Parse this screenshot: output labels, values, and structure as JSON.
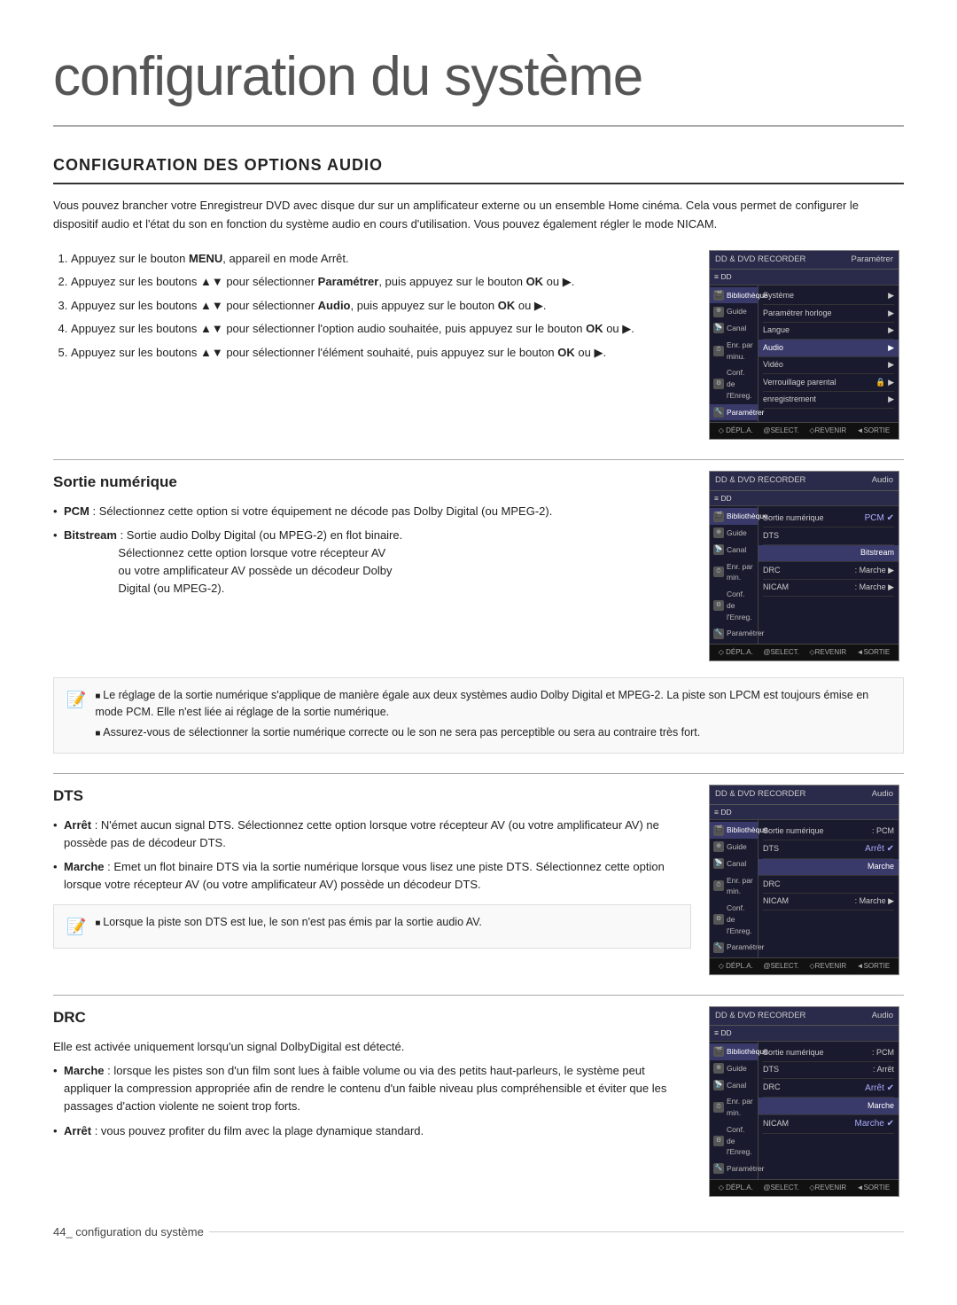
{
  "page": {
    "title": "configuration du système",
    "section_title": "CONFIGURATION DES OPTIONS AUDIO",
    "intro": "Vous pouvez brancher votre Enregistreur DVD avec disque dur sur un amplificateur externe ou un ensemble Home cinéma. Cela vous permet de configurer le dispositif audio et l'état du son en fonction du système audio en cours d'utilisation. Vous pouvez également régler le mode NICAM.",
    "footer": "44_ configuration du système"
  },
  "steps": [
    "Appuyez sur le bouton <strong>MENU</strong>, appareil en mode Arrêt.",
    "Appuyez sur les boutons ▲▼ pour sélectionner <strong>Paramétrer</strong>, puis appuyez sur le bouton <strong>OK</strong> ou ▶.",
    "Appuyez sur les boutons ▲▼ pour sélectionner <strong>Audio</strong>, puis appuyez sur le bouton <strong>OK</strong> ou ▶.",
    "Appuyez sur les boutons ▲▼ pour sélectionner l'option audio souhaitée, puis appuyez sur le bouton <strong>OK</strong> ou ▶.",
    "Appuyez sur les boutons ▲▼ pour sélectionner l'élément souhaité, puis appuyez sur le bouton <strong>OK</strong> ou ▶."
  ],
  "screen1": {
    "header_left": "DD & DVD RECORDER",
    "header_right": "Paramétrer",
    "dd_label": "≡ DD",
    "sidebar_items": [
      "Bibliothèque",
      "Guide",
      "Canal",
      "Enr. par minu.",
      "Conf. de l'Enreg.",
      "Paramétrer"
    ],
    "menu_items": [
      {
        "label": "Système",
        "value": "▶"
      },
      {
        "label": "Paramétrer horloge",
        "value": "▶"
      },
      {
        "label": "Langue",
        "value": "▶"
      },
      {
        "label": "Audio",
        "value": "▶",
        "highlighted": true
      },
      {
        "label": "Vidéo",
        "value": "▶"
      },
      {
        "label": "Verrouillage parental",
        "value": "🔒 ▶"
      },
      {
        "label": "enregistrement",
        "value": "▶"
      }
    ],
    "footer_items": [
      "◇ DÉPL.A.",
      "@SELECT.",
      "◇REVENIR",
      "◄SORTIE"
    ]
  },
  "sortie_numerique": {
    "title": "Sortie numérique",
    "bullets": [
      "<strong>PCM</strong> : Sélectionnez cette option si votre équipement ne décode pas Dolby Digital (ou MPEG-2).",
      "<strong>Bitstream</strong> : Sortie audio Dolby Digital (ou MPEG-2) en flot binaire. Sélectionnez cette option lorsque votre récepteur AV ou votre amplificateur AV possède un décodeur Dolby Digital (ou MPEG-2)."
    ],
    "notes": [
      "Le réglage de la sortie numérique s'applique de manière égale aux deux systèmes audio Dolby Digital et MPEG-2. La piste son LPCM est toujours émise en mode PCM. Elle n'est liée ai réglage de la sortie numérique.",
      "Assurez-vous de sélectionner la sortie numérique correcte ou le son ne sera pas perceptible ou sera au contraire très fort."
    ]
  },
  "screen2": {
    "header_left": "DD & DVD RECORDER",
    "header_right": "Audio",
    "dd_label": "≡ DD",
    "menu_items": [
      {
        "label": "Sortie numérique",
        "value": "PCM",
        "check": "✔"
      },
      {
        "label": "",
        "value": "DTS"
      },
      {
        "label": "",
        "value": "Bitstream",
        "highlighted": true
      },
      {
        "label": "DRC",
        "value": ": Marche",
        "arrow": "▶"
      },
      {
        "label": "NICAM",
        "value": ": Marche",
        "arrow": "▶"
      }
    ],
    "footer_items": [
      "◇ DÉPL.A.",
      "@SELECT.",
      "◇REVENIR",
      "◄SORTIE"
    ]
  },
  "dts": {
    "title": "DTS",
    "bullets": [
      "<strong>Arrêt</strong> : N'émet aucun signal DTS. Sélectionnez cette option lorsque votre récepteur AV (ou votre amplificateur AV) ne possède pas de décodeur DTS.",
      "<strong>Marche</strong> : Emet un flot binaire DTS via la sortie numérique lorsque vous lisez une piste DTS. Sélectionnez cette option lorsque votre récepteur AV (ou votre amplificateur AV) possède un décodeur DTS."
    ],
    "note": "Lorsque la piste son DTS est lue, le son n'est pas émis par la sortie audio AV."
  },
  "screen3": {
    "header_left": "DD & DVD RECORDER",
    "header_right": "Audio",
    "dd_label": "≡ DD",
    "menu_items": [
      {
        "label": "Sortie numérique",
        "value": ": PCM"
      },
      {
        "label": "DTS",
        "value": "Arrêt",
        "check": "✔"
      },
      {
        "label": "",
        "value": "Marche"
      },
      {
        "label": "DRC",
        "value": ""
      },
      {
        "label": "NICAM",
        "value": ": Marche",
        "arrow": "▶"
      }
    ],
    "footer_items": [
      "◇ DÉPL.A.",
      "@SELECT.",
      "◇REVENIR",
      "◄SORTIE"
    ]
  },
  "drc": {
    "title": "DRC",
    "intro": "Elle est activée uniquement lorsqu'un signal DolbyDigital est détecté.",
    "bullets": [
      "<strong>Marche</strong> : lorsque les pistes son d'un film sont lues à faible volume ou via des petits haut-parleurs, le système peut appliquer la compression appropriée afin de rendre le contenu d'un faible niveau plus compréhensible et éviter que les passages d'action violente ne soient trop forts.",
      "<strong>Arrêt</strong> : vous pouvez profiter du film avec la plage dynamique standard."
    ]
  },
  "screen4": {
    "header_left": "DD & DVD RECORDER",
    "header_right": "Audio",
    "dd_label": "≡ DD",
    "menu_items": [
      {
        "label": "Sortie numérique",
        "value": ": PCM"
      },
      {
        "label": "DTS",
        "value": ": Arrêt"
      },
      {
        "label": "DRC",
        "value": "Arrêt",
        "check": "✔"
      },
      {
        "label": "",
        "value": "Marche"
      },
      {
        "label": "NICAM",
        "value": "Marche",
        "check2": "✔"
      }
    ],
    "footer_items": [
      "◇ DÉPL.A.",
      "@SELECT.",
      "◇REVENIR",
      "◄SORTIE"
    ]
  }
}
